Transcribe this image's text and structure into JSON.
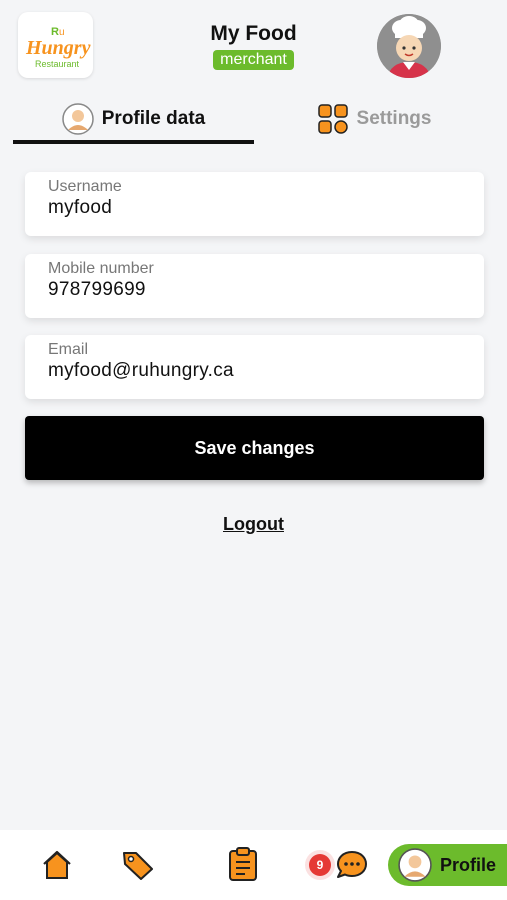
{
  "header": {
    "logo_text_top": "R",
    "logo_text_main": "Hungry",
    "logo_text_sub": "Restaurant",
    "title": "My Food",
    "role": "merchant"
  },
  "tabs": [
    {
      "label": "Profile data",
      "icon": "user-avatar-icon",
      "active": true
    },
    {
      "label": "Settings",
      "icon": "grid-icon",
      "active": false
    }
  ],
  "form": {
    "username": {
      "label": "Username",
      "value": "myfood"
    },
    "mobile": {
      "label": "Mobile number",
      "value": "978799699"
    },
    "email": {
      "label": "Email",
      "value": "myfood@ruhungry.ca"
    }
  },
  "actions": {
    "save_label": "Save changes",
    "logout_label": "Logout"
  },
  "bottom_nav": {
    "items": [
      "home-icon",
      "tag-icon",
      "clipboard-icon",
      "chat-icon"
    ],
    "chat_badge": "9",
    "profile_label": "Profile"
  },
  "colors": {
    "accent_green": "#6cbb2c",
    "icon_orange": "#f7931e",
    "button_black": "#000000",
    "badge_red": "#e53935"
  }
}
